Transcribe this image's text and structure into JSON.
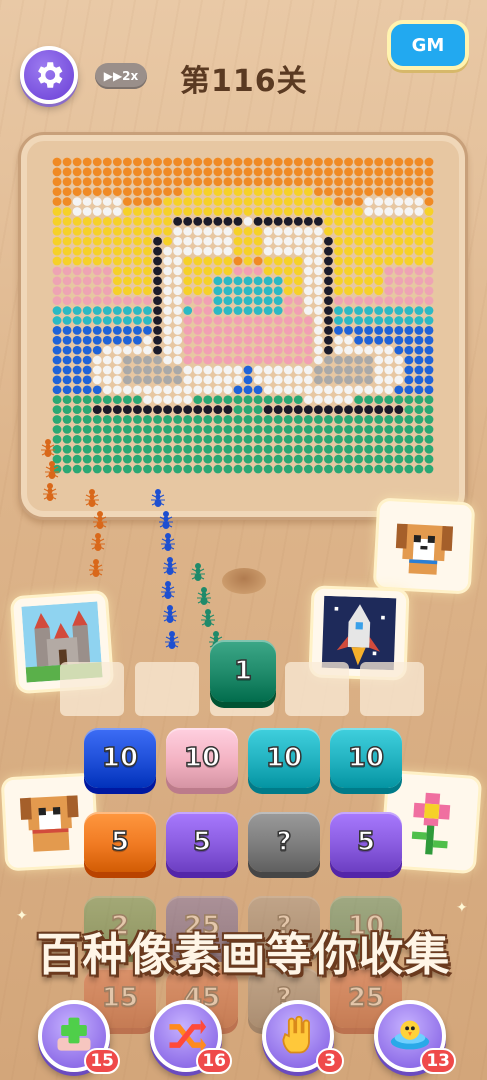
{
  "header": {
    "settings_icon": "gear-icon",
    "speed_label": "▶▶2x",
    "level_title": "第116关",
    "gm_label": "GM"
  },
  "puzzle": {
    "subject": "two swans forming a heart at sunset",
    "colors": {
      "orange": "#f08a24",
      "yellow": "#f6d128",
      "sky_pink": "#eea4b4",
      "teal": "#2bb9c4",
      "blue": "#1f63d8",
      "green": "#2aa874",
      "white": "#f4f4f4",
      "black": "#1b1b2a",
      "swan_pink": "#f2a0b4",
      "grey": "#a9a9a9"
    }
  },
  "collection_cards": [
    {
      "name": "castle",
      "icon": "castle-icon"
    },
    {
      "name": "dog-top",
      "icon": "dog-icon"
    },
    {
      "name": "rocket",
      "icon": "rocket-icon"
    },
    {
      "name": "dog-left",
      "icon": "dog-icon"
    },
    {
      "name": "flower",
      "icon": "flower-icon"
    }
  ],
  "slot_block": {
    "value": "1",
    "color": "#1f8a6a"
  },
  "blocks": {
    "row1": [
      {
        "value": "10",
        "color": "#1f4fd8"
      },
      {
        "value": "10",
        "color": "#f3b2c2"
      },
      {
        "value": "10",
        "color": "#22b2c0"
      },
      {
        "value": "10",
        "color": "#22b2c0"
      }
    ],
    "row2": [
      {
        "value": "5",
        "color": "#f07a22"
      },
      {
        "value": "5",
        "color": "#8a5ce0"
      },
      {
        "value": "?",
        "color": "#7d7d7d"
      },
      {
        "value": "5",
        "color": "#8a5ce0"
      }
    ],
    "row3": [
      {
        "value": "2",
        "color": "#2a8a4a"
      },
      {
        "value": "25",
        "color": "#3f46a8"
      },
      {
        "value": "?",
        "color": "#7d7d7d"
      },
      {
        "value": "10",
        "color": "#1f8a6a"
      }
    ],
    "row4": [
      {
        "value": "15",
        "color": "#c84a2a"
      },
      {
        "value": "45",
        "color": "#c84a2a"
      },
      {
        "value": "?",
        "color": "#7d7d7d"
      },
      {
        "value": "25",
        "color": "#c84a2a"
      }
    ]
  },
  "banner": "百种像素画等你收集",
  "tools": [
    {
      "name": "add-slot",
      "icon": "plus-icon",
      "count": "15"
    },
    {
      "name": "shuffle",
      "icon": "shuffle-icon",
      "count": "16"
    },
    {
      "name": "hand",
      "icon": "hand-icon",
      "count": "3"
    },
    {
      "name": "ufo",
      "icon": "ufo-icon",
      "count": "13"
    }
  ]
}
